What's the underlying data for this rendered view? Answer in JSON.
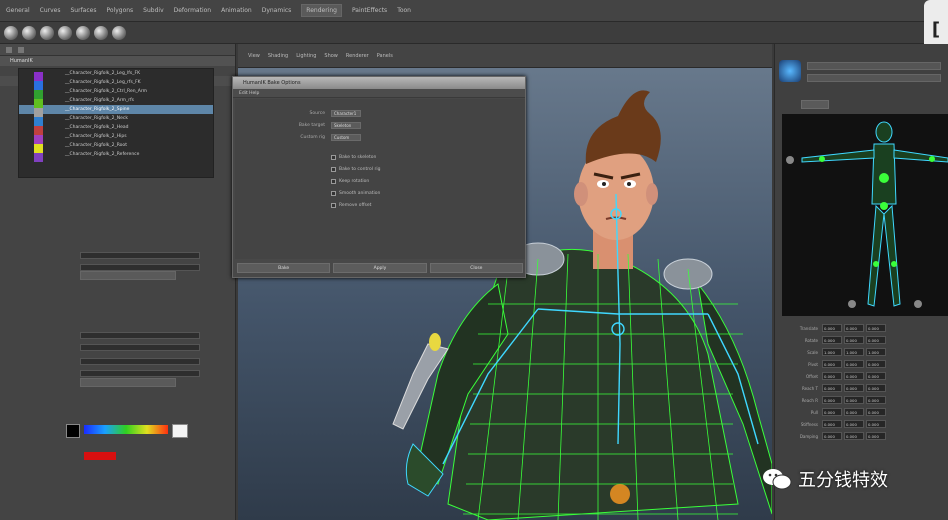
{
  "menubar": {
    "items": [
      "General",
      "Curves",
      "Surfaces",
      "Polygons",
      "Subdiv",
      "Deformation",
      "Animation",
      "Dynamics",
      "Rendering",
      "PaintEffects",
      "Toon"
    ],
    "active_index": 8
  },
  "left_panel": {
    "section_title": "HumanIK",
    "tree_rows": [
      "__Character_Rigfolk_2_Leg_lfs_FK",
      "__Character_Rigfolk_2_Leg_rfs_FK",
      "__Character_Rigfolk_2_Ctrl_Ren_Arm",
      "__Character_Rigfolk_2_Arm_rfs",
      "__Character_Rigfolk_2_Spine",
      "__Character_Rigfolk_2_Neck",
      "__Character_Rigfolk_2_Head",
      "__Character_Rigfolk_2_Hips",
      "__Character_Rigfolk_2_Root",
      "__Character_Rigfolk_2_Reference"
    ],
    "selected_row": 4,
    "swatch_colors": [
      "#8a30c8",
      "#2a70e0",
      "#30a030",
      "#60c020",
      "#a0a0a0",
      "#3080d0",
      "#c04040",
      "#a040c0",
      "#e0e020",
      "#8040c0"
    ]
  },
  "dialog": {
    "title": "HumanIK Bake Options",
    "menu": [
      "Edit",
      "Help"
    ],
    "fields": [
      {
        "label": "Source",
        "value": "Character1"
      },
      {
        "label": "Bake target",
        "value": "Skeleton"
      },
      {
        "label": "Custom rig",
        "value": "Custom"
      }
    ],
    "checkboxes": [
      "Bake to skeleton",
      "Bake to control rig",
      "Keep rotation",
      "Smooth animation",
      "Remove offset"
    ],
    "footer_buttons": [
      "Bake",
      "Apply",
      "Close"
    ]
  },
  "viewport": {
    "menu": [
      "View",
      "Shading",
      "Lighting",
      "Show",
      "Renderer",
      "Panels"
    ]
  },
  "right_panel": {
    "attr_rows": [
      {
        "label": "Translate",
        "values": [
          "0.000",
          "0.000",
          "0.000"
        ]
      },
      {
        "label": "Rotate",
        "values": [
          "0.000",
          "0.000",
          "0.000"
        ]
      },
      {
        "label": "Scale",
        "values": [
          "1.000",
          "1.000",
          "1.000"
        ]
      },
      {
        "label": "Pivot",
        "values": [
          "0.000",
          "0.000",
          "0.000"
        ]
      },
      {
        "label": "Offset",
        "values": [
          "0.000",
          "0.000",
          "0.000"
        ]
      },
      {
        "label": "Reach T",
        "values": [
          "0.000",
          "0.000",
          "0.000"
        ]
      },
      {
        "label": "Reach R",
        "values": [
          "0.000",
          "0.000",
          "0.000"
        ]
      },
      {
        "label": "Pull",
        "values": [
          "0.000",
          "0.000",
          "0.000"
        ]
      },
      {
        "label": "Stiffness",
        "values": [
          "0.000",
          "0.000",
          "0.000"
        ]
      },
      {
        "label": "Damping",
        "values": [
          "0.000",
          "0.000",
          "0.000"
        ]
      }
    ]
  },
  "watermark": {
    "text": "五分钱特效"
  },
  "colors": {
    "rig_green": "#3aff3a",
    "rig_cyan": "#3fd8ff",
    "selection_blue": "#5e86a8"
  }
}
